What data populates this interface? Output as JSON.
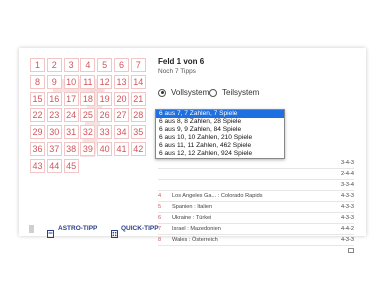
{
  "ticket": {
    "numbers": [
      "1",
      "2",
      "3",
      "4",
      "5",
      "6",
      "7",
      "8",
      "9",
      "10",
      "11",
      "12",
      "13",
      "14",
      "15",
      "16",
      "17",
      "18",
      "19",
      "20",
      "21",
      "22",
      "23",
      "24",
      "25",
      "26",
      "27",
      "28",
      "29",
      "30",
      "31",
      "32",
      "33",
      "34",
      "35",
      "36",
      "37",
      "38",
      "39",
      "40",
      "41",
      "42",
      "43",
      "44",
      "45"
    ]
  },
  "panel": {
    "title": "Feld 1 von 6",
    "subtitle": "Noch 7 Tipps",
    "system_options": [
      {
        "label": "Vollsystem",
        "selected": true
      },
      {
        "label": "Teilsystem",
        "selected": false
      }
    ],
    "dropdown_options": [
      {
        "label": "6 aus 7, 7 Zahlen, 7 Spiele",
        "selected": true
      },
      {
        "label": "6 aus 8, 8 Zahlen, 28 Spiele",
        "selected": false
      },
      {
        "label": "6 aus 9, 9 Zahlen, 84 Spiele",
        "selected": false
      },
      {
        "label": "6 aus 10, 10 Zahlen, 210 Spiele",
        "selected": false
      },
      {
        "label": "6 aus 11, 11 Zahlen, 462 Spiele",
        "selected": false
      },
      {
        "label": "6 aus 12, 12 Zahlen, 924 Spiele",
        "selected": false
      }
    ]
  },
  "matches": [
    {
      "n": "",
      "match": "",
      "result": "3-4-3"
    },
    {
      "n": "",
      "match": "",
      "result": "2-4-4"
    },
    {
      "n": "",
      "match": "",
      "result": "3-3-4"
    },
    {
      "n": "4",
      "match": "Los Angeles Ga... : Colorado Rapids",
      "result": "4-3-3"
    },
    {
      "n": "5",
      "match": "Spanien : Italien",
      "result": "4-3-3"
    },
    {
      "n": "6",
      "match": "Ukraine : Türkei",
      "result": "4-3-3"
    },
    {
      "n": "7",
      "match": "Israel : Mazedonien",
      "result": "4-4-2"
    },
    {
      "n": "8",
      "match": "Wales : Österreich",
      "result": "4-3-3"
    },
    {
      "n": "",
      "match": "",
      "result": ""
    }
  ],
  "bottom": {
    "astro_label": "ASTRO-TIPP",
    "quick_label": "QUICK-TIPP"
  },
  "colors": {
    "accent": "#d1555a",
    "selection": "#1e6fe0",
    "link": "#2a3f87"
  }
}
